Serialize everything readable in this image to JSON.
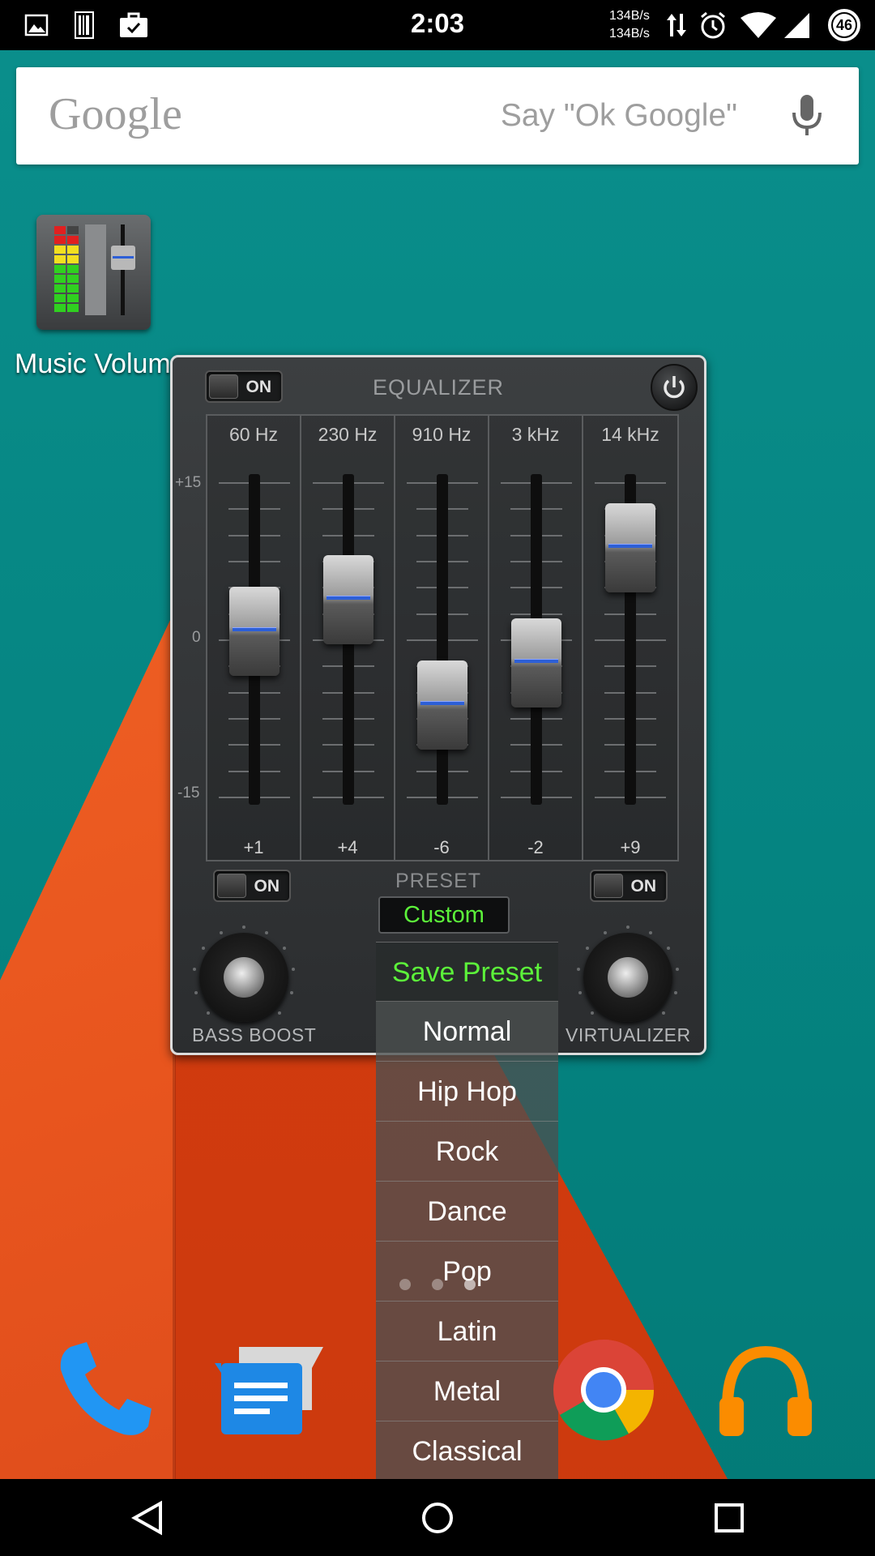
{
  "status_bar": {
    "time": "2:03",
    "rate_up": "134B/s",
    "rate_down": "134B/s",
    "battery": "46",
    "icons": [
      "image-icon",
      "barcode-icon",
      "briefcase-check-icon",
      "data-transfer-icon",
      "alarm-icon",
      "wifi-icon",
      "signal-icon",
      "battery-icon"
    ]
  },
  "search": {
    "logo": "Google",
    "hint": "Say \"Ok Google\""
  },
  "app": {
    "label": "Music Volum."
  },
  "equalizer": {
    "title": "EQUALIZER",
    "main_toggle": "ON",
    "scale": {
      "top": "+15",
      "mid": "0",
      "bottom": "-15"
    },
    "bands": [
      {
        "freq": "60 Hz",
        "value": "+1",
        "level": 1
      },
      {
        "freq": "230 Hz",
        "value": "+4",
        "level": 4
      },
      {
        "freq": "910 Hz",
        "value": "-6",
        "level": -6
      },
      {
        "freq": "3 kHz",
        "value": "-2",
        "level": -2
      },
      {
        "freq": "14 kHz",
        "value": "+9",
        "level": 9
      }
    ],
    "preset_label": "PRESET",
    "preset_value": "Custom",
    "bass_toggle": "ON",
    "virt_toggle": "ON",
    "bass_label": "BASS BOOST",
    "virt_label": "VIRTUALIZER"
  },
  "preset_menu": {
    "save": "Save Preset",
    "items": [
      "Normal",
      "Hip Hop",
      "Rock",
      "Dance",
      "Pop",
      "Latin",
      "Metal",
      "Classical"
    ]
  },
  "dock": {
    "icons": [
      "phone-icon",
      "messenger-icon",
      "chrome-icon",
      "play-music-icon"
    ]
  },
  "colors": {
    "accent_green": "#5cf23a",
    "slider_blue": "#2d5fd6"
  }
}
